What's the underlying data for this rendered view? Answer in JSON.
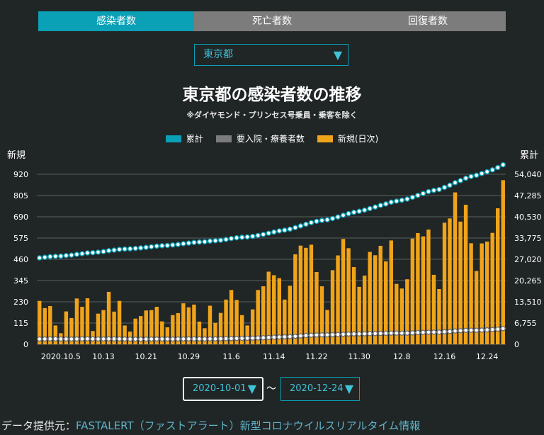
{
  "tabs": [
    {
      "label": "感染者数",
      "active": true
    },
    {
      "label": "死亡者数",
      "active": false
    },
    {
      "label": "回復者数",
      "active": false
    }
  ],
  "region_select": {
    "value": "東京都"
  },
  "chart_data": {
    "type": "bar+line",
    "title": "東京都の感染者数の推移",
    "subtitle": "※ダイヤモンド・プリンセス号乗員・乗客を除く",
    "legend": [
      {
        "name": "累計",
        "color": "#0aa0b6",
        "kind": "line"
      },
      {
        "name": "要入院・療養者数",
        "color": "#7c7c7c",
        "kind": "line"
      },
      {
        "name": "新規(日次)",
        "color": "#f0a41a",
        "kind": "bar"
      }
    ],
    "ylabel_left": "新規",
    "ylabel_right": "累計",
    "y_left_ticks": [
      "0",
      "115",
      "230",
      "345",
      "460",
      "575",
      "690",
      "805",
      "920"
    ],
    "y_right_ticks": [
      "0",
      "6,755",
      "13,510",
      "20,265",
      "27,020",
      "33,775",
      "40,530",
      "47,285",
      "54,040"
    ],
    "ylim_left": [
      0,
      920
    ],
    "ylim_right": [
      0,
      54040
    ],
    "x_tick_labels": [
      "2020.10.5",
      "10.13",
      "10.21",
      "10.29",
      "11.6",
      "11.14",
      "11.22",
      "11.30",
      "12.8",
      "12.16",
      "12.24"
    ],
    "x_tick_index": [
      4,
      12,
      20,
      28,
      36,
      44,
      52,
      60,
      68,
      76,
      84
    ],
    "start_date": "2020-10-01",
    "end_date": "2020-12-24",
    "grid": true,
    "new_cases": [
      235,
      196,
      207,
      102,
      60,
      178,
      142,
      248,
      203,
      249,
      72,
      166,
      185,
      284,
      177,
      235,
      102,
      69,
      139,
      153,
      183,
      185,
      203,
      124,
      92,
      158,
      169,
      222,
      200,
      215,
      123,
      87,
      209,
      116,
      170,
      242,
      294,
      240,
      158,
      102,
      189,
      294,
      314,
      393,
      374,
      358,
      242,
      317,
      487,
      534,
      522,
      539,
      391,
      314,
      186,
      401,
      481,
      570,
      520,
      418,
      311,
      372,
      500,
      482,
      533,
      449,
      562,
      327,
      302,
      352,
      572,
      602,
      584,
      621,
      376,
      299,
      658,
      681,
      822,
      664,
      755,
      547,
      397,
      546,
      556,
      603,
      736,
      888
    ],
    "cumulative": [
      27470,
      27666,
      27873,
      27975,
      28035,
      28213,
      28355,
      28603,
      28806,
      29055,
      29127,
      29293,
      29478,
      29762,
      29939,
      30174,
      30276,
      30345,
      30484,
      30637,
      30820,
      31005,
      31208,
      31332,
      31424,
      31582,
      31751,
      31973,
      32173,
      32388,
      32511,
      32598,
      32807,
      32923,
      33093,
      33335,
      33629,
      33869,
      34027,
      34129,
      34318,
      34612,
      34926,
      35319,
      35693,
      36051,
      36293,
      36610,
      37097,
      37631,
      38153,
      38692,
      39083,
      39397,
      39583,
      39984,
      40465,
      41035,
      41555,
      41973,
      42284,
      42656,
      43156,
      43638,
      44171,
      44620,
      45182,
      45509,
      45811,
      46163,
      46735,
      47337,
      47921,
      48542,
      48918,
      49217,
      49875,
      50556,
      51378,
      52042,
      52797,
      53344,
      53741,
      54287,
      54843,
      55446,
      56182,
      57070
    ],
    "active_cases": [
      1680,
      1700,
      1720,
      1720,
      1700,
      1690,
      1680,
      1700,
      1720,
      1740,
      1720,
      1700,
      1710,
      1730,
      1720,
      1710,
      1690,
      1670,
      1650,
      1640,
      1660,
      1680,
      1690,
      1700,
      1690,
      1680,
      1690,
      1710,
      1720,
      1730,
      1720,
      1700,
      1720,
      1730,
      1760,
      1790,
      1830,
      1880,
      1900,
      1920,
      1960,
      2020,
      2090,
      2180,
      2260,
      2330,
      2380,
      2440,
      2560,
      2680,
      2790,
      2900,
      2960,
      3000,
      3010,
      3060,
      3110,
      3200,
      3270,
      3300,
      3310,
      3340,
      3390,
      3420,
      3470,
      3500,
      3550,
      3560,
      3540,
      3550,
      3640,
      3720,
      3780,
      3850,
      3880,
      3870,
      3980,
      4080,
      4230,
      4330,
      4440,
      4480,
      4470,
      4530,
      4600,
      4690,
      4820,
      5000
    ]
  },
  "date_range": {
    "start": "2020-10-01",
    "end": "2020-12-24",
    "separator": "〜"
  },
  "footer": {
    "label": "データ提供元：",
    "source": "FASTALERT（ファストアラート）新型コロナウイルスリアルタイム情報"
  },
  "colors": {
    "accent": "#0aa0b6",
    "bar": "#f0a41a",
    "inactive_tab": "#7c7c7c",
    "background": "#202526",
    "active_marker": "#7c7c7c"
  },
  "icons": {
    "dropdown": "triangle-down-icon"
  }
}
